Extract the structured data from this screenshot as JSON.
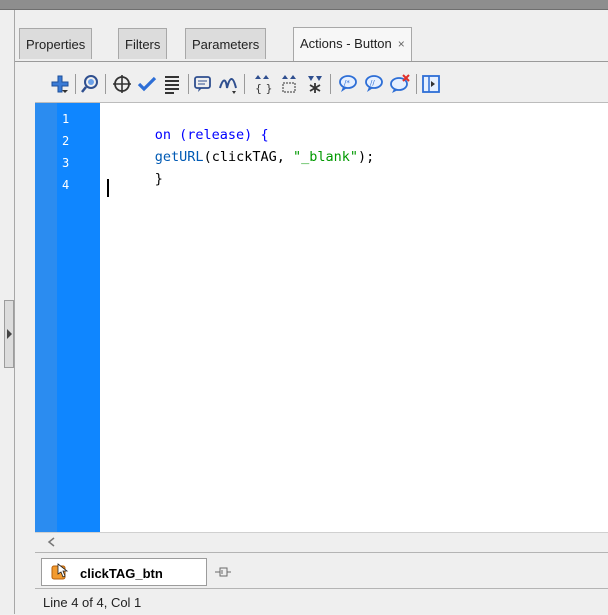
{
  "tabs": [
    {
      "label": "Properties",
      "active": false
    },
    {
      "label": "Filters",
      "active": false
    },
    {
      "label": "Parameters",
      "active": false
    },
    {
      "label": "Actions - Button",
      "active": true,
      "close": "×"
    }
  ],
  "toolbar": {
    "icons": [
      "add-script-item-icon",
      "find-icon",
      "insert-target-path-icon",
      "check-syntax-icon",
      "auto-format-icon",
      "show-code-hint-icon",
      "debug-options-icon",
      "collapse-between-braces-icon",
      "collapse-selection-icon",
      "expand-all-icon",
      "apply-block-comment-icon",
      "apply-line-comment-icon",
      "remove-comment-icon",
      "show-hide-toolbox-icon"
    ]
  },
  "editor": {
    "line_numbers": [
      "1",
      "2",
      "3",
      "4"
    ],
    "lines": [
      [
        {
          "t": "on (release) {",
          "c": "kw"
        }
      ],
      [
        {
          "t": "getURL",
          "c": "fn"
        },
        {
          "t": "(clickTAG, ",
          "c": "plain"
        },
        {
          "t": "\"_blank\"",
          "c": "str"
        },
        {
          "t": ");",
          "c": "plain"
        }
      ],
      [
        {
          "t": "}",
          "c": "plain"
        }
      ],
      []
    ]
  },
  "file_tab": {
    "label": "clickTAG_btn"
  },
  "status": {
    "text": "Line 4 of 4, Col 1"
  },
  "colors": {
    "line_number_gutter": "#0f86ff",
    "keyword": "#0000ff",
    "string": "#009900"
  }
}
